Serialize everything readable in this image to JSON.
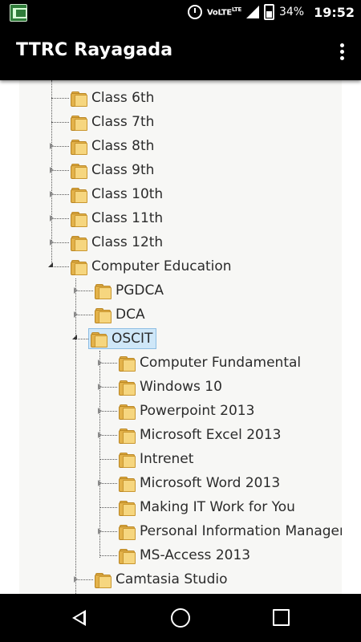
{
  "status_bar": {
    "app_icon": "app-notification-icon",
    "network": "VoLTE",
    "network_sub": "LTE",
    "battery_percent": "34%",
    "time": "19:52"
  },
  "app_bar": {
    "title": "TTRC Rayagada",
    "menu_icon": "overflow-menu-icon"
  },
  "tree": {
    "level1": [
      {
        "label": "Class 6th",
        "expandable": false
      },
      {
        "label": "Class 7th",
        "expandable": false
      },
      {
        "label": "Class 8th",
        "expandable": true
      },
      {
        "label": "Class 9th",
        "expandable": true
      },
      {
        "label": "Class 10th",
        "expandable": true
      },
      {
        "label": "Class 11th",
        "expandable": true
      },
      {
        "label": "Class 12th",
        "expandable": true
      },
      {
        "label": "Computer Education",
        "expandable": true,
        "expanded": true
      }
    ],
    "computer_education": [
      {
        "label": "PGDCA",
        "expandable": true
      },
      {
        "label": "DCA",
        "expandable": true
      },
      {
        "label": "OSCIT",
        "expandable": true,
        "expanded": true,
        "selected": true
      },
      {
        "label": "Camtasia Studio",
        "expandable": true
      }
    ],
    "oscit": [
      {
        "label": "Computer Fundamental",
        "expandable": true
      },
      {
        "label": "Windows 10",
        "expandable": true
      },
      {
        "label": "Powerpoint 2013",
        "expandable": true
      },
      {
        "label": "Microsoft Excel 2013",
        "expandable": true
      },
      {
        "label": "Intrenet",
        "expandable": false
      },
      {
        "label": "Microsoft Word 2013",
        "expandable": true
      },
      {
        "label": "Making IT Work for You",
        "expandable": false
      },
      {
        "label": "Personal Information Manager",
        "expandable": true
      },
      {
        "label": "MS-Access 2013",
        "expandable": false
      }
    ]
  },
  "nav_bar": {
    "back_icon": "back-icon",
    "home_icon": "home-icon",
    "recents_icon": "recents-icon"
  }
}
